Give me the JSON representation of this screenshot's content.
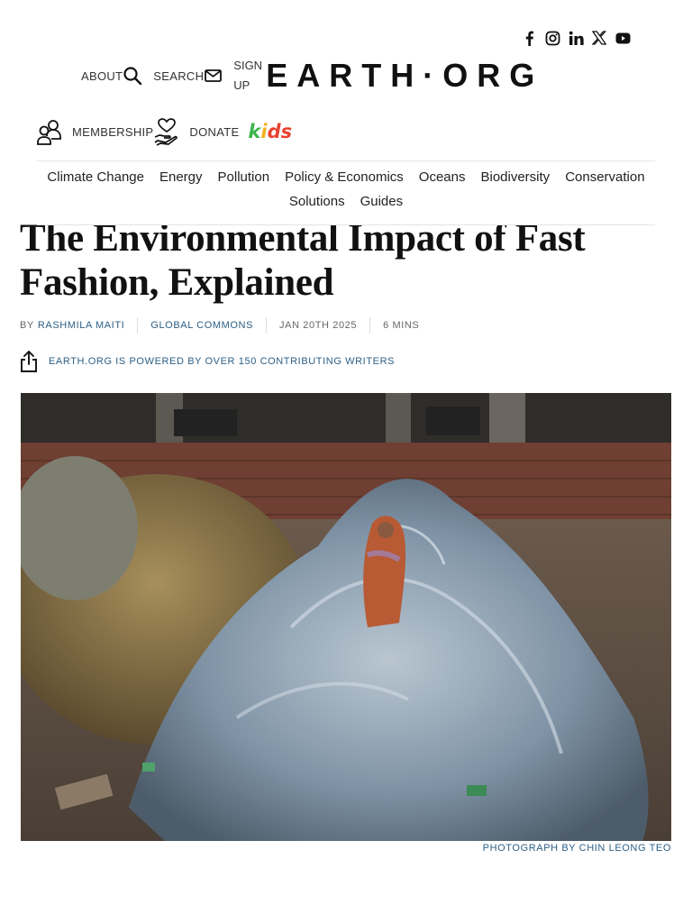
{
  "social": {
    "icons": [
      "facebook-icon",
      "instagram-icon",
      "linkedin-icon",
      "x-icon",
      "youtube-icon"
    ]
  },
  "header": {
    "about": "ABOUT",
    "search": "SEARCH",
    "signup_line1": "SIGN",
    "signup_line2": "UP",
    "logo": "EARTH·ORG"
  },
  "secondary": {
    "membership": "MEMBERSHIP",
    "donate": "DONATE",
    "kids": [
      "k",
      "i",
      "d",
      "s"
    ],
    "kids_colors": [
      "#3db54a",
      "#f5b21c",
      "#e8442f",
      "#e8442f"
    ]
  },
  "categories": {
    "row1": [
      "Climate Change",
      "Energy",
      "Pollution",
      "Policy & Economics",
      "Oceans",
      "Biodiversity",
      "Conservation"
    ],
    "row2": [
      "Solutions",
      "Guides"
    ]
  },
  "article": {
    "title": "The Environmental Impact of Fast Fashion, Explained",
    "by": "BY",
    "author": "RASHMILA MAITI",
    "section": "GLOBAL COMMONS",
    "date": "JAN 20TH 2025",
    "read_time": "6 MINS",
    "powered_by": "EARTH.ORG IS POWERED BY OVER 150 CONTRIBUTING WRITERS",
    "photo_credit": "PHOTOGRAPH BY CHIN LEONG TEO"
  },
  "colors": {
    "link": "#2c5f85",
    "text": "#222222"
  }
}
